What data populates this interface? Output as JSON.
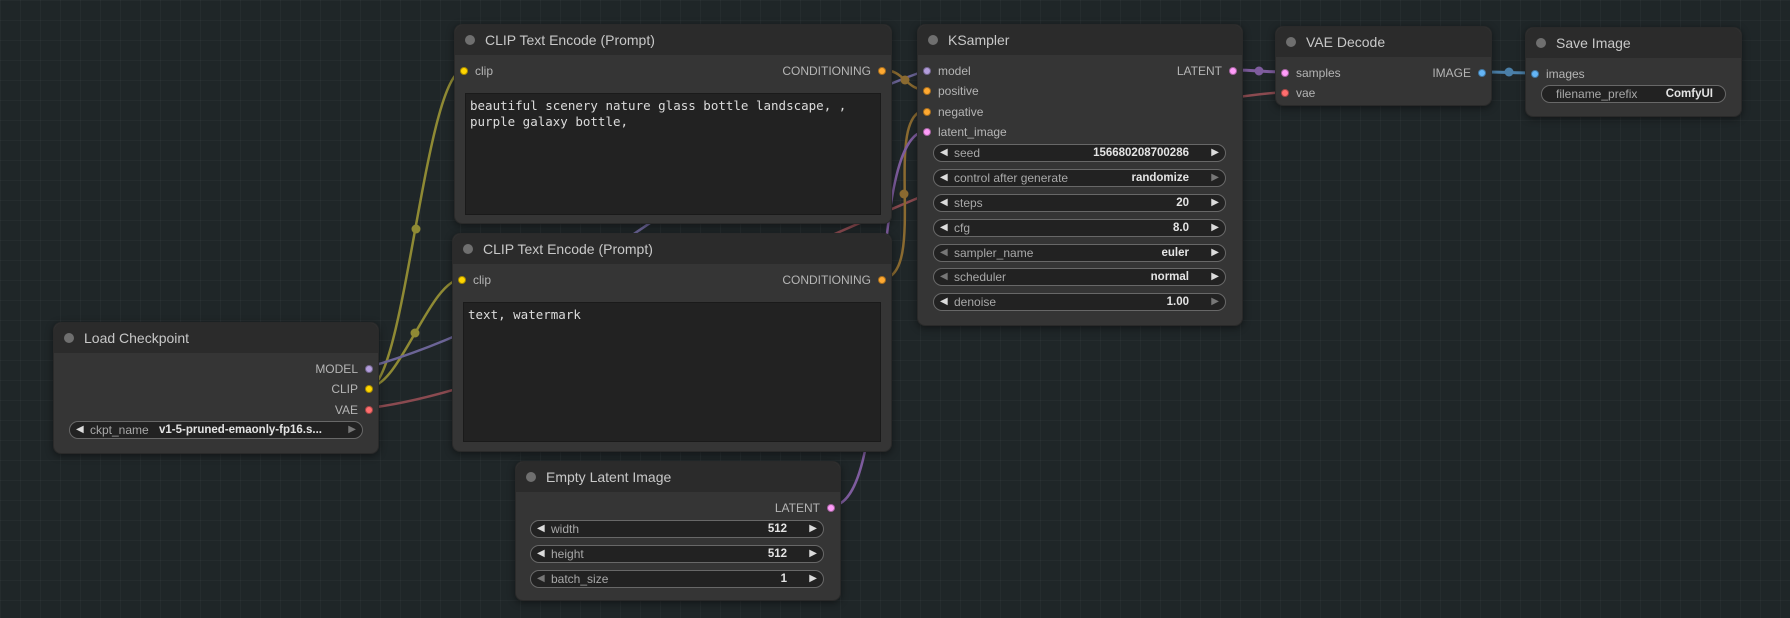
{
  "colors": {
    "model": "#b39ddb",
    "clip": "#ffd500",
    "vae": "#ff6e6e",
    "conditioning": "#ffa931",
    "latent": "#ff9cf9",
    "image": "#64b5f6"
  },
  "nodes": {
    "clip_pos": {
      "title": "CLIP Text Encode (Prompt)",
      "input": "clip",
      "output": "CONDITIONING",
      "text": "beautiful scenery nature glass bottle landscape, , purple galaxy bottle,"
    },
    "clip_neg": {
      "title": "CLIP Text Encode (Prompt)",
      "input": "clip",
      "output": "CONDITIONING",
      "text": "text, watermark"
    },
    "ksampler": {
      "title": "KSampler",
      "inputs": [
        "model",
        "positive",
        "negative",
        "latent_image"
      ],
      "output": "LATENT",
      "widgets": [
        {
          "label": "seed",
          "value": "156680208700286"
        },
        {
          "label": "control after generate",
          "value": "randomize"
        },
        {
          "label": "steps",
          "value": "20"
        },
        {
          "label": "cfg",
          "value": "8.0"
        },
        {
          "label": "sampler_name",
          "value": "euler"
        },
        {
          "label": "scheduler",
          "value": "normal"
        },
        {
          "label": "denoise",
          "value": "1.00"
        }
      ]
    },
    "vae_decode": {
      "title": "VAE Decode",
      "inputs": [
        "samples",
        "vae"
      ],
      "output": "IMAGE"
    },
    "save_image": {
      "title": "Save Image",
      "input": "images",
      "widget": {
        "label": "filename_prefix",
        "value": "ComfyUI"
      }
    },
    "load_checkpoint": {
      "title": "Load Checkpoint",
      "outputs": [
        "MODEL",
        "CLIP",
        "VAE"
      ],
      "widget": {
        "label": "ckpt_name",
        "value": "v1-5-pruned-emaonly-fp16.s..."
      }
    },
    "empty_latent": {
      "title": "Empty Latent Image",
      "output": "LATENT",
      "widgets": [
        {
          "label": "width",
          "value": "512"
        },
        {
          "label": "height",
          "value": "512"
        },
        {
          "label": "batch_size",
          "value": "1"
        }
      ]
    }
  }
}
